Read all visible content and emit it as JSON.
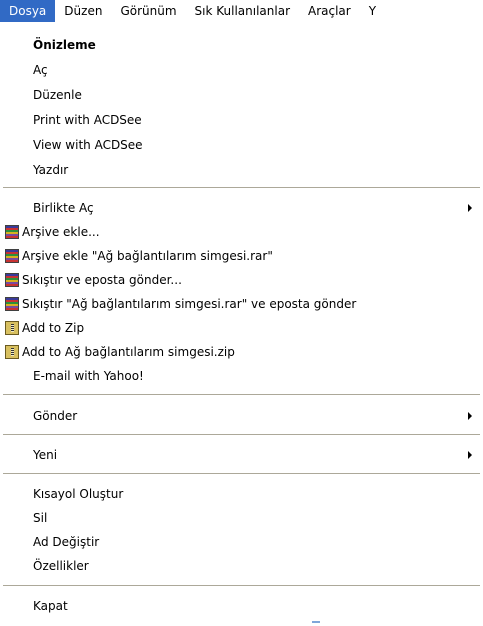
{
  "menubar": {
    "items": [
      {
        "label": "Dosya"
      },
      {
        "label": "Düzen"
      },
      {
        "label": "Görünüm"
      },
      {
        "label": "Sık Kullanılanlar"
      },
      {
        "label": "Araçlar"
      },
      {
        "label": "Y"
      }
    ]
  },
  "menu": {
    "items": [
      {
        "label": "Önizleme"
      },
      {
        "label": "Aç"
      },
      {
        "label": "Düzenle"
      },
      {
        "label": "Print with ACDSee"
      },
      {
        "label": "View with ACDSee"
      },
      {
        "label": "Yazdır"
      },
      {
        "label": "Birlikte Aç"
      },
      {
        "label": "Arşive ekle...",
        "icon": "winrar-icon"
      },
      {
        "label": "Arşive ekle \"Ağ bağlantılarım simgesi.rar\"",
        "icon": "winrar-icon"
      },
      {
        "label": "Sıkıştır ve eposta gönder...",
        "icon": "winrar-icon"
      },
      {
        "label": "Sıkıştır \"Ağ bağlantılarım simgesi.rar\" ve eposta gönder",
        "icon": "winrar-icon"
      },
      {
        "label": "Add to Zip",
        "icon": "winzip-icon"
      },
      {
        "label": "Add to Ağ bağlantılarım simgesi.zip",
        "icon": "winzip-icon"
      },
      {
        "label": "E-mail with Yahoo!"
      },
      {
        "label": "Gönder"
      },
      {
        "label": "Yeni"
      },
      {
        "label": "Kısayol Oluştur"
      },
      {
        "label": "Sil"
      },
      {
        "label": "Ad Değiştir"
      },
      {
        "label": "Özellikler"
      },
      {
        "label": "Kapat"
      }
    ]
  },
  "colors": {
    "highlight": "#316ac5",
    "separator": "#aca899"
  }
}
